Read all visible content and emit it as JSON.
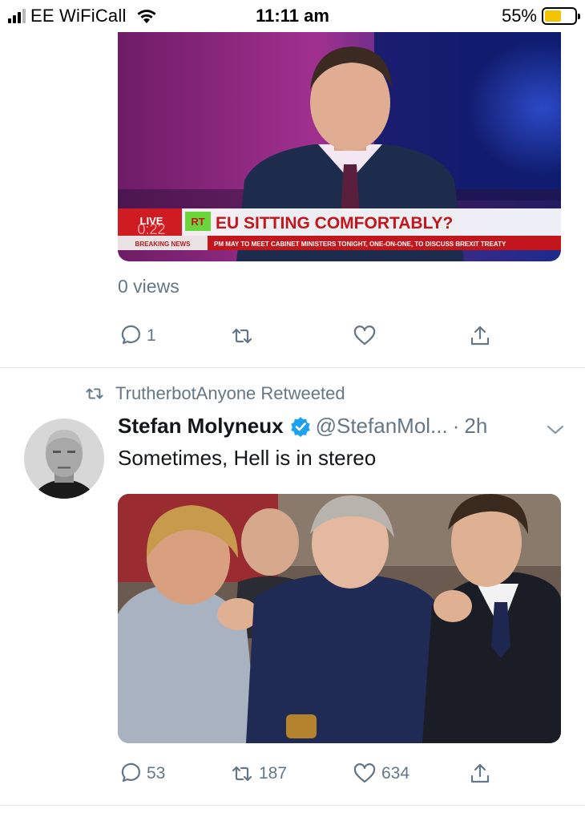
{
  "status_bar": {
    "carrier": "EE WiFiCall",
    "time": "11:11 am",
    "battery": "55%",
    "battery_level": 0.55
  },
  "tweet1": {
    "media": {
      "live_badge": "LIVE",
      "channel_logo": "RT",
      "breaking_label": "BREAKING NEWS",
      "headline": "EU SITTING COMFORTABLY?",
      "ticker": "PM MAY TO MEET CABINET MINISTERS TONIGHT, ONE-ON-ONE, TO DISCUSS BREXIT TREATY",
      "timer": "0:22"
    },
    "views": "0 views",
    "actions": {
      "reply_count": "1",
      "retweet_count": "",
      "like_count": ""
    }
  },
  "tweet2": {
    "retweeted_by": "TrutherbotAnyone Retweeted",
    "author_name": "Stefan Molyneux",
    "handle": "@StefanMol...",
    "dot": "·",
    "time_ago": "2h",
    "text": "Sometimes, Hell is in stereo",
    "actions": {
      "reply_count": "53",
      "retweet_count": "187",
      "like_count": "634"
    }
  },
  "icons": [
    "signal-icon",
    "wifi-icon",
    "battery-icon",
    "reply-icon",
    "retweet-icon",
    "like-icon",
    "share-icon",
    "verified-icon",
    "chevron-down-icon"
  ],
  "colors": {
    "secondary_text": "#657786",
    "verified_blue": "#1da1f2",
    "divider": "#e1e8ed",
    "battery_fill": "#f5c400"
  }
}
